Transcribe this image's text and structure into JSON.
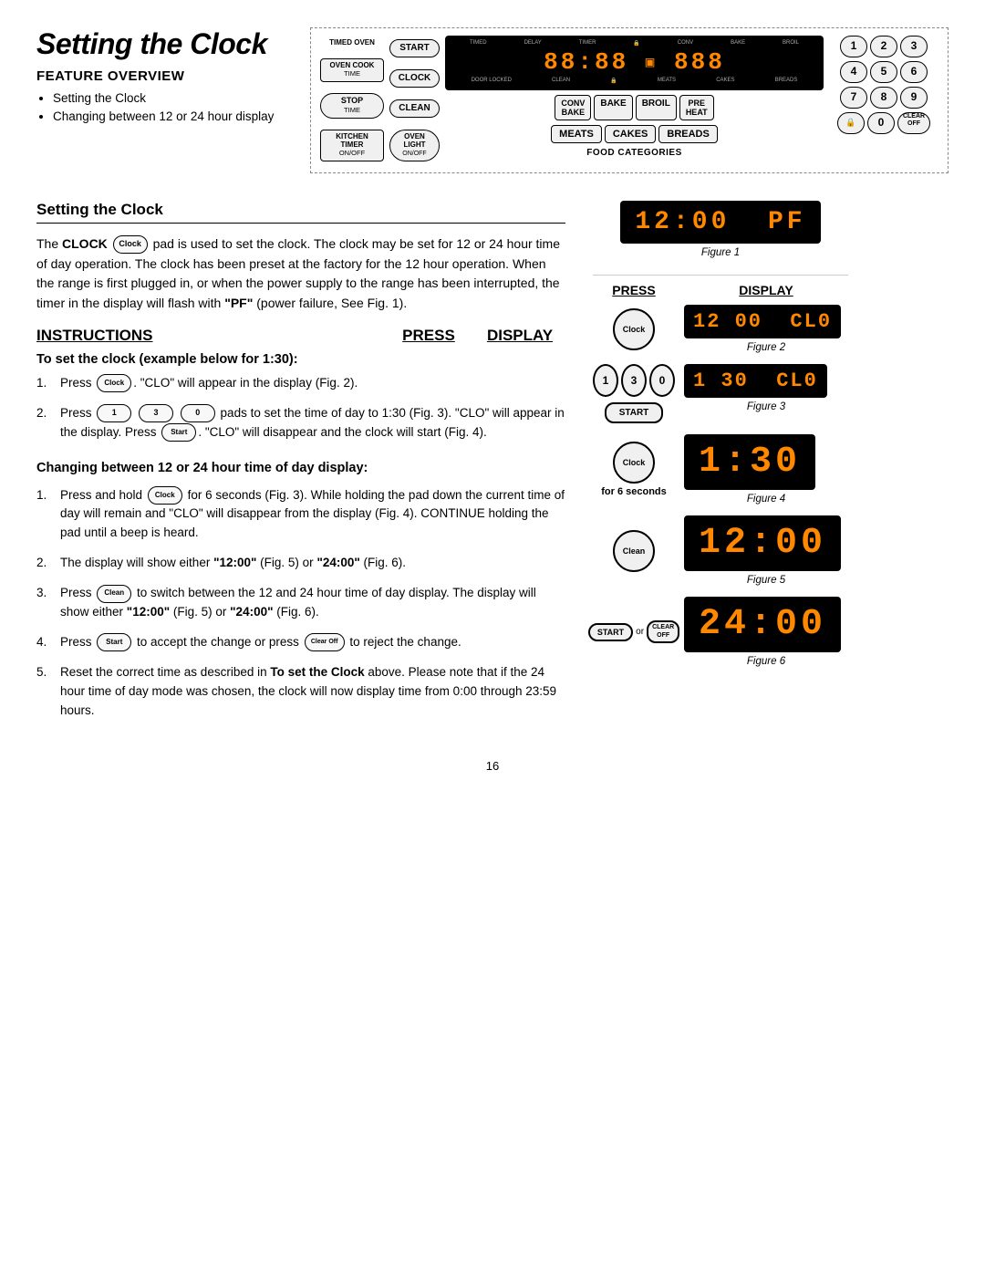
{
  "page": {
    "title": "Setting the Clock",
    "page_number": "16"
  },
  "header": {
    "main_title": "Setting the Clock",
    "feature_overview": "FEATURE OVERVIEW",
    "feature_items": [
      "Setting the Clock",
      "Changing between 12 or 24 hour display"
    ]
  },
  "panel": {
    "display": "88:88 888",
    "indicators": [
      "TIMED",
      "DELAY",
      "TIMER",
      "CONV",
      "BAKE",
      "BROIL",
      "DOOR LOCKED",
      "CLEAN",
      "MEATS",
      "CAKES",
      "BREADS"
    ],
    "buttons_left": [
      {
        "label": "START",
        "shape": "oval"
      },
      {
        "label": "CLOCK",
        "shape": "oval"
      },
      {
        "label": "CLEAN",
        "shape": "oval"
      },
      {
        "label": "OVEN LIGHT",
        "shape": "oval"
      }
    ],
    "buttons_side_left": [
      {
        "label": "TIMED OVEN"
      },
      {
        "label": "OVEN COOK TIME"
      },
      {
        "label": "STOP TIME"
      },
      {
        "label": "KITCHEN TIMER",
        "sub": "ON/OFF"
      }
    ],
    "function_buttons": [
      {
        "main": "CONV",
        "sub": "BAKE"
      },
      {
        "main": "BAKE",
        "sub": ""
      },
      {
        "main": "BROIL",
        "sub": ""
      },
      {
        "main": "PRE",
        "sub": "HEAT"
      }
    ],
    "food_buttons": [
      "MEATS",
      "CAKES",
      "BREADS"
    ],
    "food_categories_label": "FOOD CATEGORIES",
    "numpad": [
      "1",
      "2",
      "3",
      "4",
      "5",
      "6",
      "7",
      "8",
      "9",
      "0"
    ],
    "clear_off_btn": "CLEAR OFF",
    "onoff_labels": [
      "ON/OFF",
      "ON/OFF"
    ]
  },
  "content": {
    "section_title": "Setting the Clock",
    "intro": [
      "The ",
      "CLOCK",
      " pad is used to set the clock. The clock may be set for 12 or 24 hour time of day operation. The clock has been preset at the factory for the 12 hour operation. When the range is first plugged in, or when the power supply to the range has been interrupted, the timer in the display will flash with ",
      "\"PF\"",
      " (power failure, See Fig. 1)."
    ],
    "instructions_label": "INSTRUCTIONS",
    "press_label": "PRESS",
    "display_label": "DISPLAY",
    "subsection1_title": "To set the clock (example below for 1:30):",
    "steps1": [
      {
        "num": "1.",
        "text_parts": [
          "Press ",
          "CLOCK",
          ". \"CLO\" will appear in the display (Fig. 2)."
        ]
      },
      {
        "num": "2.",
        "text_parts": [
          "Press ",
          "1",
          " ",
          "3",
          " ",
          "0",
          " pads to set the time of day to 1:30 (Fig. 3). \"CLO\" will appear in the display.  Press ",
          "START",
          ". \"CLO\" will disappear and the clock will start (Fig. 4)."
        ]
      }
    ],
    "subsection2_title": "Changing between 12 or 24 hour time of day display:",
    "steps2": [
      {
        "num": "1.",
        "text_parts": [
          "Press and hold ",
          "CLOCK",
          " for 6 seconds (Fig. 3). While holding the pad down the current time of day will remain and \"CLO\" will disappear from the display (Fig. 4). CONTINUE holding the pad until a beep is heard."
        ]
      },
      {
        "num": "2.",
        "text_parts": [
          "The display will show either \"",
          "12:00",
          "\" (Fig. 5) or \"",
          "24:00",
          "\" (Fig. 6)."
        ]
      },
      {
        "num": "3.",
        "text_parts": [
          "Press ",
          "CLEAN",
          " to switch between the 12 and 24 hour time of day display. The display will show either \"",
          "12:00",
          "\" (Fig. 5) or \"",
          "24:00",
          "\" (Fig. 6)."
        ]
      },
      {
        "num": "4.",
        "text_parts": [
          "Press ",
          "START",
          " to accept the change or press ",
          "CLEAR OFF",
          " to reject the change."
        ]
      },
      {
        "num": "5.",
        "text_parts": [
          "Reset the correct time as described in ",
          "To set the Clock",
          " above. Please note that if the 24 hour time of day mode was chosen, the clock will now display time from 0:00 through 23:59 hours."
        ]
      }
    ]
  },
  "figures": [
    {
      "label": "Figure 1",
      "display": "12:00  PF",
      "size": "normal"
    },
    {
      "label": "Figure 2",
      "display": "12 00  CL0",
      "size": "normal"
    },
    {
      "label": "Figure 3",
      "display": "1 30  CL0",
      "size": "normal"
    },
    {
      "label": "Figure 4",
      "display": "1:30",
      "size": "large"
    },
    {
      "label": "Figure 5",
      "display": "12:00",
      "size": "large"
    },
    {
      "label": "Figure 6",
      "display": "24:00",
      "size": "large"
    }
  ]
}
